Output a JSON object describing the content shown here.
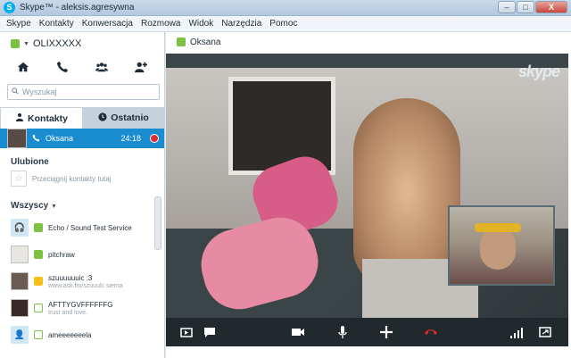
{
  "window": {
    "title": "Skype™ - aleksis.agresywna"
  },
  "window_buttons": {
    "minimize": "–",
    "maximize": "□",
    "close": "X"
  },
  "menu": [
    "Skype",
    "Kontakty",
    "Konwersacja",
    "Rozmowa",
    "Widok",
    "Narzędzia",
    "Pomoc"
  ],
  "user": {
    "name": "OLIXXXXX"
  },
  "search": {
    "placeholder": "Wyszukaj"
  },
  "tabs": {
    "contacts": "Kontakty",
    "recent": "Ostatnio"
  },
  "active_call": {
    "name": "Oksana",
    "duration": "24:18"
  },
  "favorites": {
    "title": "Ulubione",
    "drop_hint": "Przeciągnij kontakty tutaj"
  },
  "all": {
    "title": "Wszyscy"
  },
  "contacts": [
    {
      "name": "Echo / Sound Test Service",
      "mood": ""
    },
    {
      "name": "pitchraw",
      "mood": ""
    },
    {
      "name": "szuuuuuuic :3",
      "mood": "www.ask.fm/szuuulc siema"
    },
    {
      "name": "AFTTYGVFFFFFFG",
      "mood": "trust and love."
    },
    {
      "name": "ameeeeeeela",
      "mood": ""
    }
  ],
  "conversation": {
    "title": "Oksana"
  },
  "skype_logo": "skype",
  "colors": {
    "accent": "#1a8dd1",
    "online": "#7cc142",
    "hangup": "#e02d2d",
    "video_bar": "#22292c"
  }
}
